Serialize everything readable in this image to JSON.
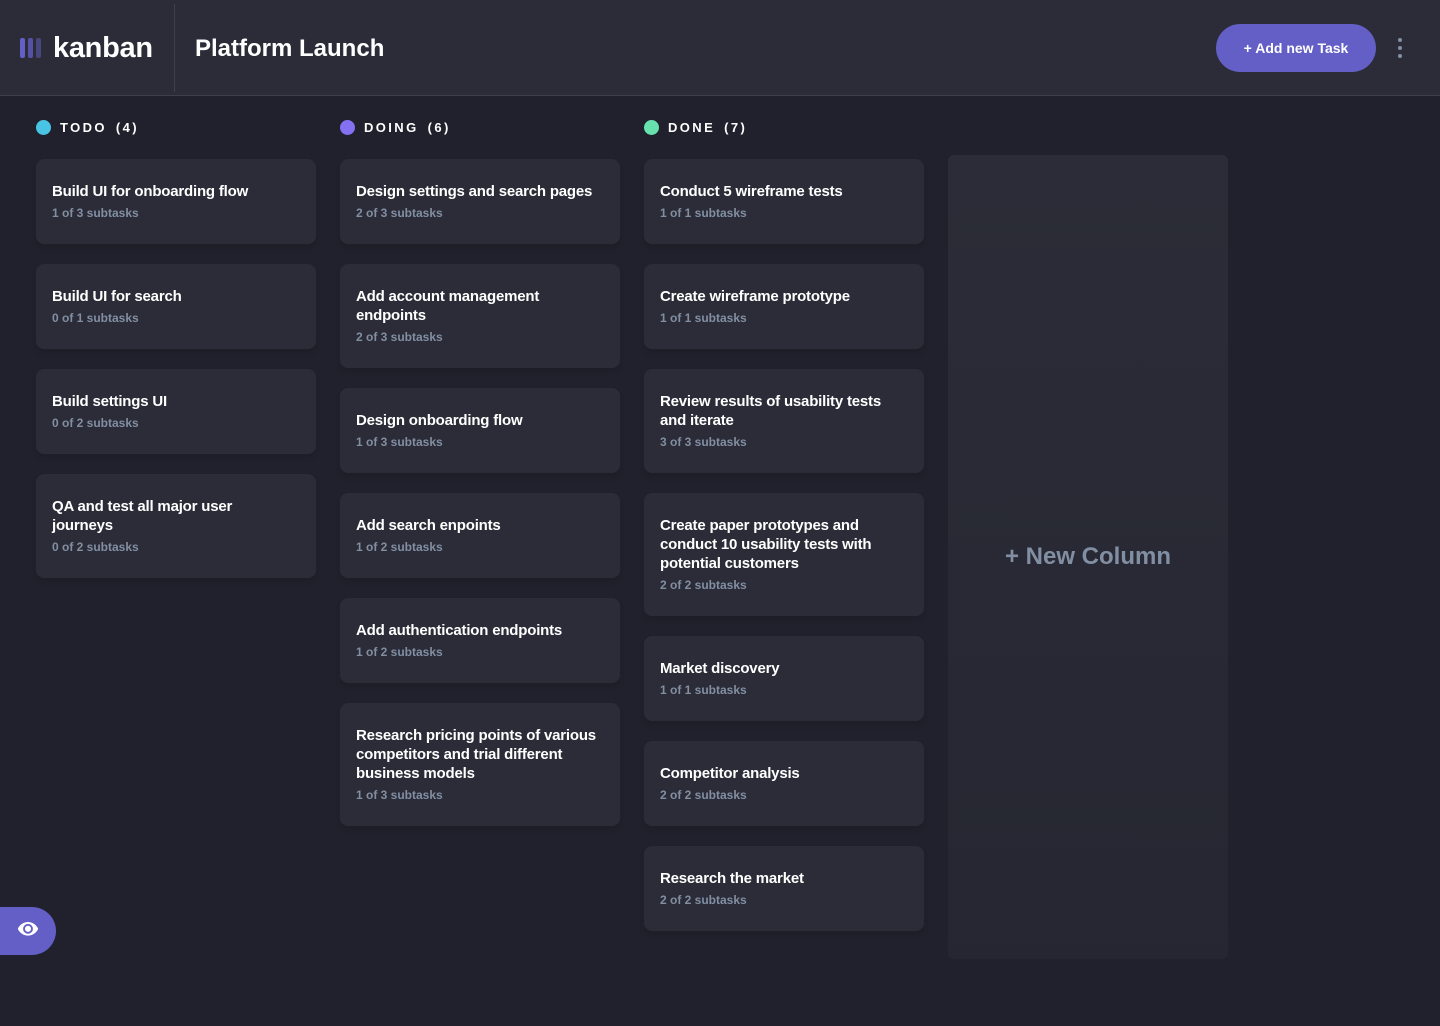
{
  "app": {
    "logo_text": "kanban",
    "accent_color": "#635FC7"
  },
  "header": {
    "board_title": "Platform Launch",
    "add_task_label": "+ Add new Task",
    "menu_icon": "vertical-ellipsis-icon"
  },
  "columns": [
    {
      "name": "TODO",
      "count": "(4)",
      "dot_color": "#49C4E5",
      "tasks": [
        {
          "title": "Build UI for onboarding flow",
          "subtasks": "1 of 3 subtasks"
        },
        {
          "title": "Build UI for search",
          "subtasks": "0 of 1 subtasks"
        },
        {
          "title": "Build settings UI",
          "subtasks": "0 of 2 subtasks"
        },
        {
          "title": "QA and test all major user journeys",
          "subtasks": "0 of 2 subtasks"
        }
      ]
    },
    {
      "name": "DOING",
      "count": "(6)",
      "dot_color": "#8471F2",
      "tasks": [
        {
          "title": "Design settings and search pages",
          "subtasks": "2 of 3 subtasks"
        },
        {
          "title": "Add account management endpoints",
          "subtasks": "2 of 3 subtasks"
        },
        {
          "title": "Design onboarding flow",
          "subtasks": "1 of 3 subtasks"
        },
        {
          "title": "Add search enpoints",
          "subtasks": "1 of 2 subtasks"
        },
        {
          "title": "Add authentication endpoints",
          "subtasks": "1 of 2 subtasks"
        },
        {
          "title": "Research pricing points of various competitors and trial different business models",
          "subtasks": "1 of 3 subtasks"
        }
      ]
    },
    {
      "name": "DONE",
      "count": "(7)",
      "dot_color": "#67E2AE",
      "tasks": [
        {
          "title": "Conduct 5 wireframe tests",
          "subtasks": "1 of 1 subtasks"
        },
        {
          "title": "Create wireframe prototype",
          "subtasks": "1 of 1 subtasks"
        },
        {
          "title": "Review results of usability tests and iterate",
          "subtasks": "3 of 3 subtasks"
        },
        {
          "title": "Create paper prototypes and conduct 10 usability tests with potential customers",
          "subtasks": "2 of 2 subtasks"
        },
        {
          "title": "Market discovery",
          "subtasks": "1 of 1 subtasks"
        },
        {
          "title": "Competitor analysis",
          "subtasks": "2 of 2 subtasks"
        },
        {
          "title": "Research the market",
          "subtasks": "2 of 2 subtasks"
        }
      ]
    }
  ],
  "new_column_label": "+ New Column",
  "show_sidebar_icon": "eye-icon"
}
